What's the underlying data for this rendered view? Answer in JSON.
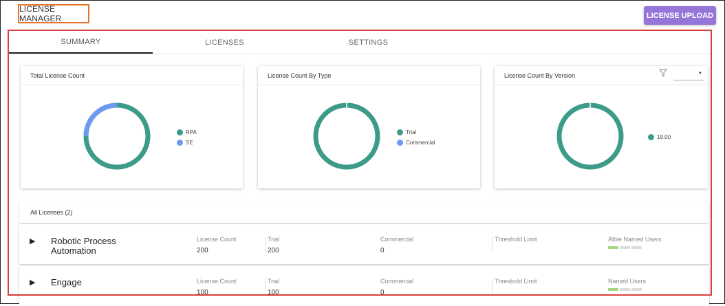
{
  "header": {
    "title": "LICENSE MANAGER",
    "upload_label": "LICENSE UPLOAD"
  },
  "tabs": [
    {
      "label": "SUMMARY",
      "active": true
    },
    {
      "label": "LICENSES",
      "active": false
    },
    {
      "label": "SETTINGS",
      "active": false
    }
  ],
  "colors": {
    "rpa": "#3d9b8a",
    "se": "#6b9af0",
    "accent": "#9575d8",
    "outline": "#d9403a"
  },
  "cards": {
    "total": {
      "title": "Total License Count",
      "legend": [
        "RPA",
        "SE"
      ]
    },
    "by_type": {
      "title": "License Count By Type",
      "legend": [
        "Trial",
        "Commercial"
      ]
    },
    "by_version": {
      "title": "License Count By Version",
      "legend": [
        "19.00"
      ],
      "filter_icon": "filter-icon"
    }
  },
  "chart_data": [
    {
      "type": "pie",
      "title": "Total License Count",
      "labels": [
        "RPA",
        "SE"
      ],
      "values": [
        300,
        100
      ]
    },
    {
      "type": "pie",
      "title": "License Count By Type",
      "labels": [
        "Trial",
        "Commercial"
      ],
      "values": [
        300,
        0
      ]
    },
    {
      "type": "pie",
      "title": "License Count By Version",
      "labels": [
        "19.00"
      ],
      "values": [
        300
      ]
    }
  ],
  "all_licenses": {
    "title": "All Licenses (2)",
    "columns": [
      "License Count",
      "Trial",
      "Commercial",
      "Threshold Limit"
    ],
    "rows": [
      {
        "name_line1": "Robotic Process",
        "name_line2": "Automation",
        "license_count": "200",
        "trial": "200",
        "commercial": "0",
        "threshold_limit": "",
        "users_label": "Albie Named Users",
        "users_level": 0.25
      },
      {
        "name_line1": "Engage",
        "name_line2": "",
        "license_count": "100",
        "trial": "100",
        "commercial": "0",
        "threshold_limit": "",
        "users_label": "Named Users",
        "users_level": 0.25
      }
    ]
  }
}
